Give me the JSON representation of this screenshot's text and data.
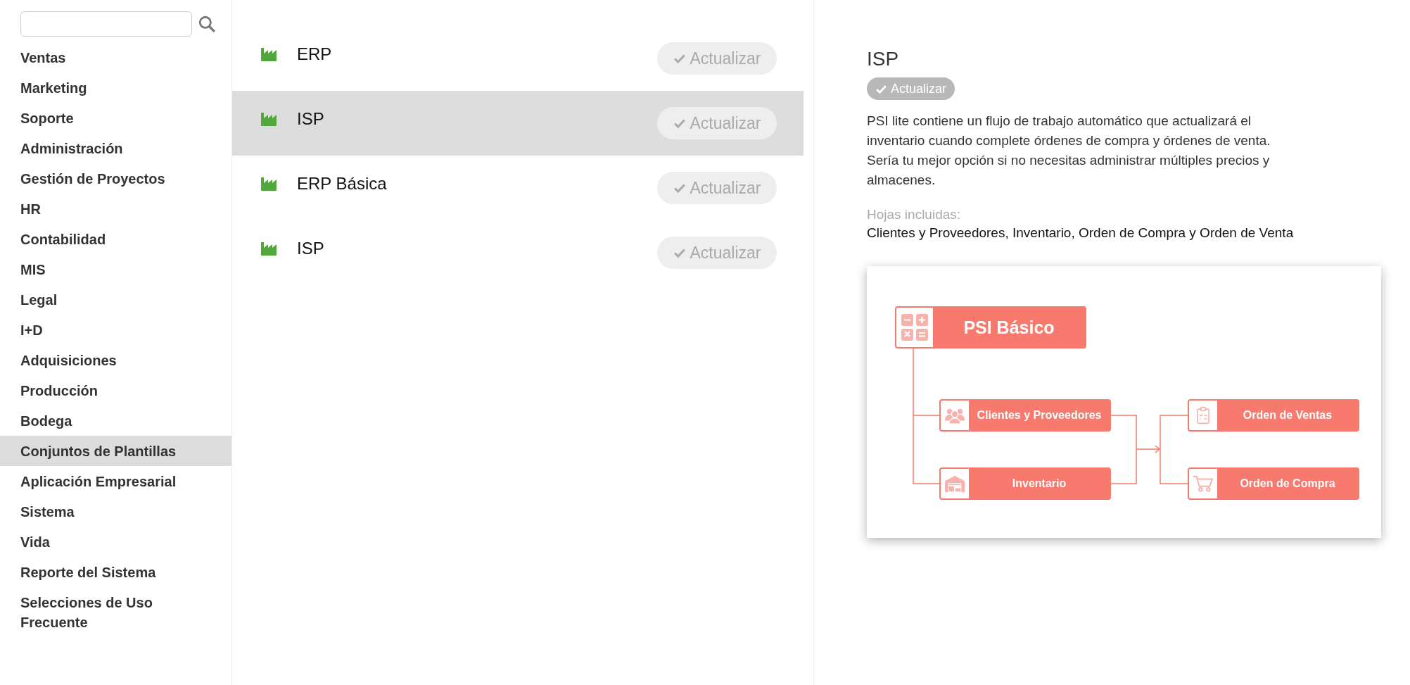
{
  "sidebar": {
    "items": [
      {
        "label": "Ventas",
        "selected": false
      },
      {
        "label": "Marketing",
        "selected": false
      },
      {
        "label": "Soporte",
        "selected": false
      },
      {
        "label": "Administración",
        "selected": false
      },
      {
        "label": "Gestión de Proyectos",
        "selected": false
      },
      {
        "label": "HR",
        "selected": false
      },
      {
        "label": "Contabilidad",
        "selected": false
      },
      {
        "label": "MIS",
        "selected": false
      },
      {
        "label": "Legal",
        "selected": false
      },
      {
        "label": "I+D",
        "selected": false
      },
      {
        "label": "Adquisiciones",
        "selected": false
      },
      {
        "label": "Producción",
        "selected": false
      },
      {
        "label": "Bodega",
        "selected": false
      },
      {
        "label": "Conjuntos de Plantillas",
        "selected": true
      },
      {
        "label": "Aplicación Empresarial",
        "selected": false
      },
      {
        "label": "Sistema",
        "selected": false
      },
      {
        "label": "Vida",
        "selected": false
      },
      {
        "label": "Reporte del Sistema",
        "selected": false
      },
      {
        "label": "Selecciones de Uso Frecuente",
        "selected": false
      }
    ]
  },
  "templates": [
    {
      "name": "ERP",
      "selected": false,
      "button": "Actualizar"
    },
    {
      "name": "ISP",
      "selected": true,
      "button": "Actualizar"
    },
    {
      "name": "ERP Básica",
      "selected": false,
      "button": "Actualizar"
    },
    {
      "name": "ISP",
      "selected": false,
      "button": "Actualizar"
    }
  ],
  "detail": {
    "title": "ISP",
    "button": "Actualizar",
    "description": "PSI lite contiene un flujo de trabajo automático que actualizará el inventario cuando complete órdenes de compra y órdenes de venta. Sería tu mejor opción si no necesitas administrar múltiples precios y almacenes.",
    "sheets_label": "Hojas incluidas:",
    "sheets": "Clientes y Proveedores, Inventario, Orden de Compra y Orden de Venta",
    "diagram": {
      "main": {
        "label": "PSI Básico",
        "kind": "calculator"
      },
      "nodes": [
        {
          "label": "Clientes y Proveedores",
          "kind": "people"
        },
        {
          "label": "Inventario",
          "kind": "warehouse"
        },
        {
          "label": "Orden de Ventas",
          "kind": "clipboard"
        },
        {
          "label": "Orden de Compra",
          "kind": "cart"
        }
      ]
    }
  }
}
